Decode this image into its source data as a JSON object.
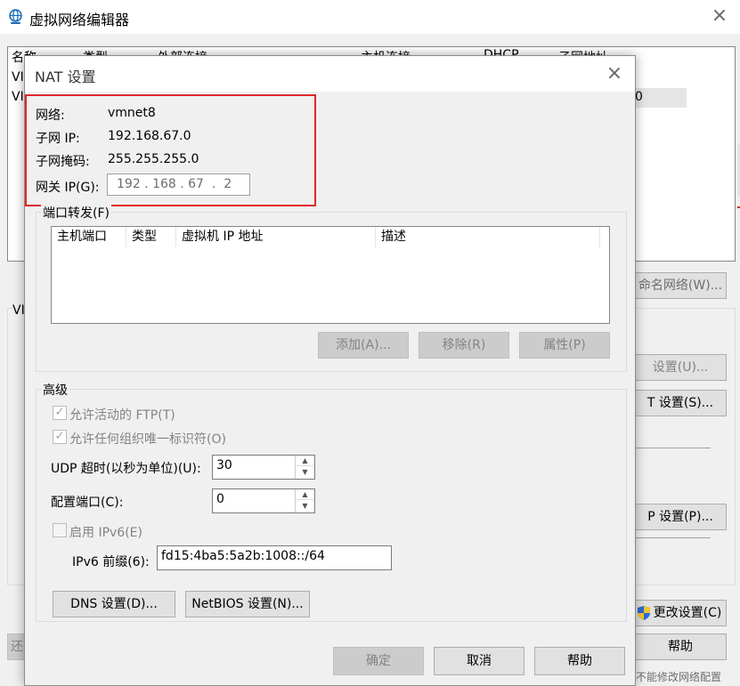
{
  "background_window": {
    "title": "虚拟网络编辑器",
    "close_icon": "×",
    "table_headers": [
      "名称",
      "类型",
      "外部连接",
      "主机连接",
      "DHCP",
      "子网地址"
    ],
    "rows_fragments": [
      "VI",
      "VI"
    ],
    "row2_fragment": "0",
    "rename_button_label": "命名网络(W)...",
    "label_fragment_vi": "VI",
    "settings_button_u": "设置(U)...",
    "nat_settings_button": "T 设置(S)...",
    "dhcp_settings_button": "P 设置(P)...",
    "change_settings_button": "更改设置(C)",
    "help_button": "帮助",
    "restore_fragment": "还",
    "bottom_fragment": "不能修改网络配置"
  },
  "dialog": {
    "title": "NAT 设置",
    "close_icon": "×",
    "network_label": "网络:",
    "network_value": "vmnet8",
    "subnet_ip_label": "子网 IP:",
    "subnet_ip_value": "192.168.67.0",
    "subnet_mask_label": "子网掩码:",
    "subnet_mask_value": "255.255.255.0",
    "gateway_label": "网关 IP(G):",
    "gateway_value": "192 . 168 . 67  .  2",
    "port_forwarding": {
      "title": "端口转发(F)",
      "columns": [
        "主机端口",
        "类型",
        "虚拟机 IP 地址",
        "描述"
      ],
      "add_button": "添加(A)...",
      "remove_button": "移除(R)",
      "properties_button": "属性(P)"
    },
    "advanced": {
      "title": "高级",
      "allow_ftp_label": "允许活动的 FTP(T)",
      "allow_ftp_checked": true,
      "allow_uuid_label": "允许任何组织唯一标识符(O)",
      "allow_uuid_checked": true,
      "udp_timeout_label": "UDP 超时(以秒为单位)(U):",
      "udp_timeout_value": "30",
      "config_port_label": "配置端口(C):",
      "config_port_value": "0",
      "enable_ipv6_label": "启用 IPv6(E)",
      "enable_ipv6_checked": false,
      "ipv6_prefix_label": "IPv6 前缀(6):",
      "ipv6_prefix_value": "fd15:4ba5:5a2b:1008::/64",
      "dns_button": "DNS 设置(D)...",
      "netbios_button": "NetBIOS 设置(N)..."
    },
    "ok_button": "确定",
    "cancel_button": "取消",
    "help_button": "帮助"
  },
  "colors": {
    "highlight_border": "#e0262b",
    "shield_blue": "#2b6cd4",
    "shield_yellow": "#f4c430",
    "globe_blue": "#1f6fb5"
  }
}
